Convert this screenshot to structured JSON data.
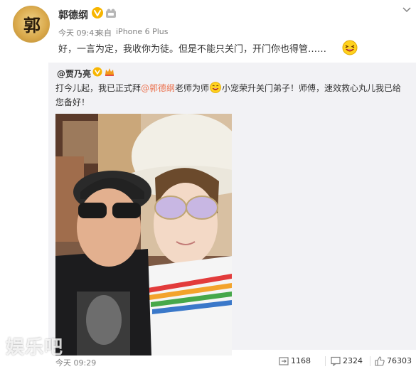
{
  "author": {
    "name": "郭德纲",
    "avatar_text": "郭"
  },
  "meta": {
    "time": "今天 09:43",
    "source_label": "来自",
    "source": "iPhone 6 Plus"
  },
  "post": {
    "text": "好，一言为定，我收你为徒。但是不能只关门，开门你也得管……"
  },
  "repost": {
    "user": "@贾乃亮",
    "line1_prefix": "打今儿起，我已正式拜",
    "mention": "@郭德纲",
    "line1_mid": "老师为师",
    "line1_suffix": "小宠荣升关门弟子！师傅，速效救心丸儿我已给",
    "line2": "您备好！",
    "date": "今天 09:29"
  },
  "actions": {
    "reposts": "1168",
    "comments": "2324",
    "likes": "76303"
  },
  "watermark": {
    "text": "娱乐吧"
  },
  "colors": {
    "mention": "#eb7350",
    "meta": "#808080",
    "repost_bg": "#f2f2f5",
    "badge": "#f7b500"
  },
  "icons": [
    "vip-badge-icon",
    "member-icon",
    "chevron-down-icon",
    "laugh-emoji-icon",
    "smile-emoji-icon",
    "repost-icon",
    "comment-icon",
    "like-icon"
  ]
}
